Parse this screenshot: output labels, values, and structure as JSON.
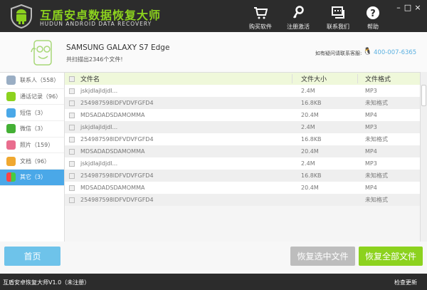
{
  "app": {
    "title": "互盾安卓数据恢复大师",
    "subtitle": "HUDUN ANDROID DATA RECOVERY"
  },
  "toolbar": [
    {
      "label": "购买软件",
      "icon": "cart-icon"
    },
    {
      "label": "注册激活",
      "icon": "key-icon"
    },
    {
      "label": "联系我们",
      "icon": "chat-icon"
    },
    {
      "label": "帮助",
      "icon": "help-icon"
    }
  ],
  "window": {
    "minimize": "–",
    "maximize": "□",
    "close": "×"
  },
  "device": {
    "name": "SAMSUNG  GALAXY S7 Edge",
    "scan_result": "共扫描出2346个文件!",
    "help_text": "如有疑问请联系客服:",
    "phone": "400-007-6365"
  },
  "sidebar": {
    "items": [
      {
        "label": "联系人（558）",
        "color": "#9aaec4"
      },
      {
        "label": "通话记录（96）",
        "color": "#8cd21e"
      },
      {
        "label": "短信（3）",
        "color": "#4aa8e8"
      },
      {
        "label": "微信（3）",
        "color": "#44b035"
      },
      {
        "label": "照片（159）",
        "color": "#e96d8e"
      },
      {
        "label": "文档（96）",
        "color": "#f0a830"
      },
      {
        "label": "其它（3）",
        "color": "#ffffff",
        "active": true
      }
    ]
  },
  "table": {
    "headers": [
      "文件名",
      "文件大小",
      "文件格式"
    ],
    "rows": [
      [
        "jskjdlajldjdl...",
        "2.4M",
        "MP3"
      ],
      [
        "254987598IDFVDVFGFD4",
        "16.8KB",
        "未知格式"
      ],
      [
        "MDSADADSDAMOMMA",
        "20.4M",
        "MP4"
      ],
      [
        "jskjdlajldjdl...",
        "2.4M",
        "MP3"
      ],
      [
        "254987598IDFVDVFGFD4",
        "16.8KB",
        "未知格式"
      ],
      [
        "MDSADADSDAMOMMA",
        "20.4M",
        "MP4"
      ],
      [
        "jskjdlajldjdl...",
        "2.4M",
        "MP3"
      ],
      [
        "254987598IDFVDVFGFD4",
        "16.8KB",
        "未知格式"
      ],
      [
        "MDSADADSDAMOMMA",
        "20.4M",
        "MP4"
      ],
      [
        "254987598IDFVDVFGFD4",
        "",
        "未知格式"
      ]
    ]
  },
  "buttons": {
    "home": "首页",
    "recover_selected": "恢复选中文件",
    "recover_all": "恢复全部文件"
  },
  "footer": {
    "version": "互盾安卓恢复大师V1.0（未注册）",
    "update": "检查更新"
  },
  "colors": {
    "accent_green": "#8cd21e",
    "accent_blue": "#4aa8e8",
    "home_button": "#6ec3ea",
    "disabled": "#bdbdbd"
  }
}
